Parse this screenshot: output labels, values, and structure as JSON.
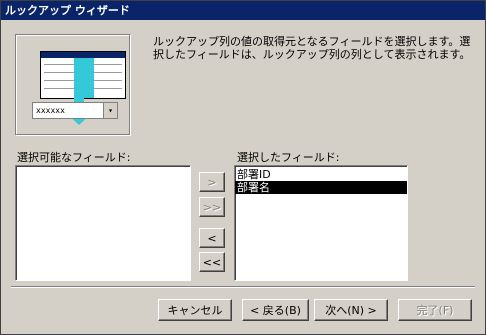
{
  "window": {
    "title": "ルックアップ ウィザード"
  },
  "illustration": {
    "combo_text": "xxxxxx",
    "combo_arrow": "▾"
  },
  "instructions": "ルックアップ列の値の取得元となるフィールドを選択します。選択したフィールドは、ルックアップ列の列として表示されます。",
  "available": {
    "label": "選択可能なフィールド:",
    "items": []
  },
  "selected": {
    "label": "選択したフィールド:",
    "items": [
      "部署ID",
      "部署名"
    ],
    "selected_index": 1
  },
  "move_buttons": {
    "add_one": ">",
    "add_all": ">>",
    "remove_one": "<",
    "remove_all": "<<"
  },
  "footer": {
    "cancel": "キャンセル",
    "back": "< 戻る(B)",
    "next": "次へ(N) >",
    "finish": "完了(F)"
  }
}
